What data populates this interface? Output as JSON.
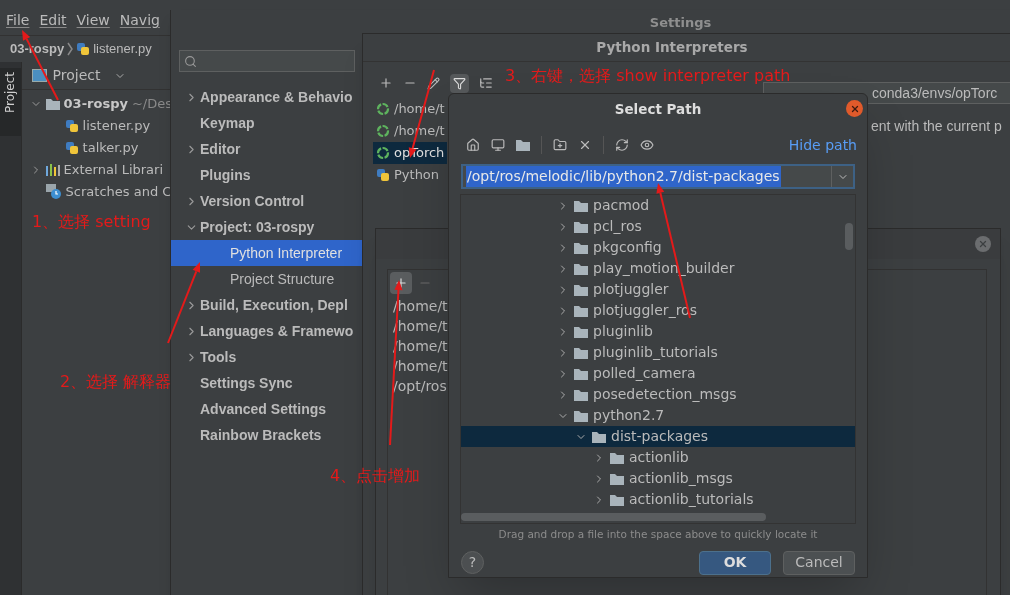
{
  "ide": {
    "menu": [
      "File",
      "Edit",
      "View",
      "Navig"
    ],
    "breadcrumb": [
      "03-rospy",
      "listener.py"
    ],
    "tool_tab": "Project",
    "project_header": "Project",
    "tree": [
      {
        "name": "03-rospy",
        "hint": "~/Des",
        "kind": "folder",
        "expanded": true,
        "children": [
          {
            "name": "listener.py",
            "kind": "python"
          },
          {
            "name": "talker.py",
            "kind": "python"
          }
        ]
      },
      {
        "name": "External Librari",
        "kind": "library",
        "expanded": false
      },
      {
        "name": "Scratches and C",
        "kind": "scratch"
      }
    ]
  },
  "settings": {
    "title": "Settings",
    "nav": [
      {
        "label": "Appearance & Behavio",
        "kind": "group",
        "expanded": false,
        "selected": false
      },
      {
        "label": "Keymap",
        "kind": "item",
        "selected": false
      },
      {
        "label": "Editor",
        "kind": "group",
        "expanded": false,
        "selected": false
      },
      {
        "label": "Plugins",
        "kind": "item",
        "selected": false
      },
      {
        "label": "Version Control",
        "kind": "group",
        "expanded": false,
        "selected": false
      },
      {
        "label": "Project: 03-rospy",
        "kind": "group",
        "expanded": true,
        "selected": false,
        "children": [
          {
            "label": "Python Interpreter",
            "kind": "item",
            "selected": true
          },
          {
            "label": "Project Structure",
            "kind": "item",
            "selected": false
          }
        ]
      },
      {
        "label": "Build, Execution, Depl",
        "kind": "group",
        "expanded": false,
        "selected": false
      },
      {
        "label": "Languages & Framewo",
        "kind": "group",
        "expanded": false,
        "selected": false
      },
      {
        "label": "Tools",
        "kind": "group",
        "expanded": false,
        "selected": false
      },
      {
        "label": "Settings Sync",
        "kind": "item",
        "selected": false
      },
      {
        "label": "Advanced Settings",
        "kind": "item",
        "selected": false
      },
      {
        "label": "Rainbow Brackets",
        "kind": "item",
        "selected": false
      }
    ]
  },
  "interpreters": {
    "title": "Python Interpreters",
    "items": [
      {
        "label": "/home/t",
        "kind": "conda",
        "selected": false
      },
      {
        "label": "/home/t",
        "kind": "conda",
        "selected": false
      },
      {
        "label": "opTorch",
        "kind": "conda",
        "selected": true
      },
      {
        "label": "Python",
        "kind": "python",
        "selected": false
      }
    ],
    "path_field": "conda3/envs/opTorc",
    "note": "ent with the current p"
  },
  "interpreter_paths": {
    "paths": [
      "/home/t",
      "/home/t",
      "/home/t",
      "/home/t",
      "/opt/ros"
    ]
  },
  "select_path": {
    "title": "Select Path",
    "hide_path": "Hide path",
    "path": "/opt/ros/melodic/lib/python2.7/dist-packages",
    "tree": [
      {
        "name": "pacmod",
        "expanded": false,
        "selected": false
      },
      {
        "name": "pcl_ros",
        "expanded": false,
        "selected": false
      },
      {
        "name": "pkgconfig",
        "expanded": false,
        "selected": false
      },
      {
        "name": "play_motion_builder",
        "expanded": false,
        "selected": false
      },
      {
        "name": "plotjuggler",
        "expanded": false,
        "selected": false
      },
      {
        "name": "plotjuggler_ros",
        "expanded": false,
        "selected": false
      },
      {
        "name": "pluginlib",
        "expanded": false,
        "selected": false
      },
      {
        "name": "pluginlib_tutorials",
        "expanded": false,
        "selected": false
      },
      {
        "name": "polled_camera",
        "expanded": false,
        "selected": false
      },
      {
        "name": "posedetection_msgs",
        "expanded": false,
        "selected": false
      },
      {
        "name": "python2.7",
        "expanded": true,
        "selected": false,
        "children": [
          {
            "name": "dist-packages",
            "expanded": true,
            "selected": true,
            "children": [
              {
                "name": "actionlib",
                "expanded": false,
                "selected": false
              },
              {
                "name": "actionlib_msgs",
                "expanded": false,
                "selected": false
              },
              {
                "name": "actionlib_tutorials",
                "expanded": false,
                "selected": false
              }
            ]
          }
        ]
      }
    ],
    "hint": "Drag and drop a file into the space above to quickly locate it",
    "help": "?",
    "ok": "OK",
    "cancel": "Cancel"
  },
  "annotations": [
    {
      "text": "1、选择 setting"
    },
    {
      "text": "2、选择 解释器"
    },
    {
      "text": "3、右键，选择 show interpreter path"
    },
    {
      "text": "4、点击增加"
    }
  ]
}
